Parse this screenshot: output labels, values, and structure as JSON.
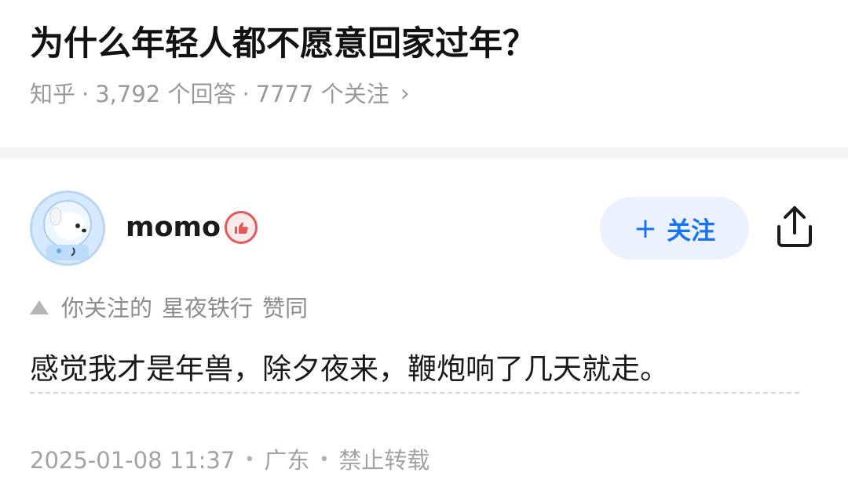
{
  "question": {
    "title": "为什么年轻人都不愿意回家过年？",
    "source": "知乎",
    "answers": "3,792 个回答",
    "followers": "7777 个关注",
    "chevron": "›"
  },
  "author": {
    "name": "momo",
    "avatar_icon": "astronaut-dog-avatar",
    "badge_icon": "thumb-up-badge-icon"
  },
  "actions": {
    "follow_plus": "+",
    "follow_label": "关注",
    "share_icon": "share-icon"
  },
  "endorsement": {
    "prefix": "你关注的",
    "endorser": "星夜铁行",
    "action": "赞同"
  },
  "answer": {
    "content": "感觉我才是年兽，除夕夜来，鞭炮响了几天就走。"
  },
  "footer": {
    "date": "2025-01-08 11:37",
    "location": "广东",
    "rights": "禁止转载",
    "separator": "•"
  },
  "colors": {
    "accent": "#1772f6",
    "follow_bg": "#ebf2fd",
    "meta_gray": "#9a9a9a"
  }
}
